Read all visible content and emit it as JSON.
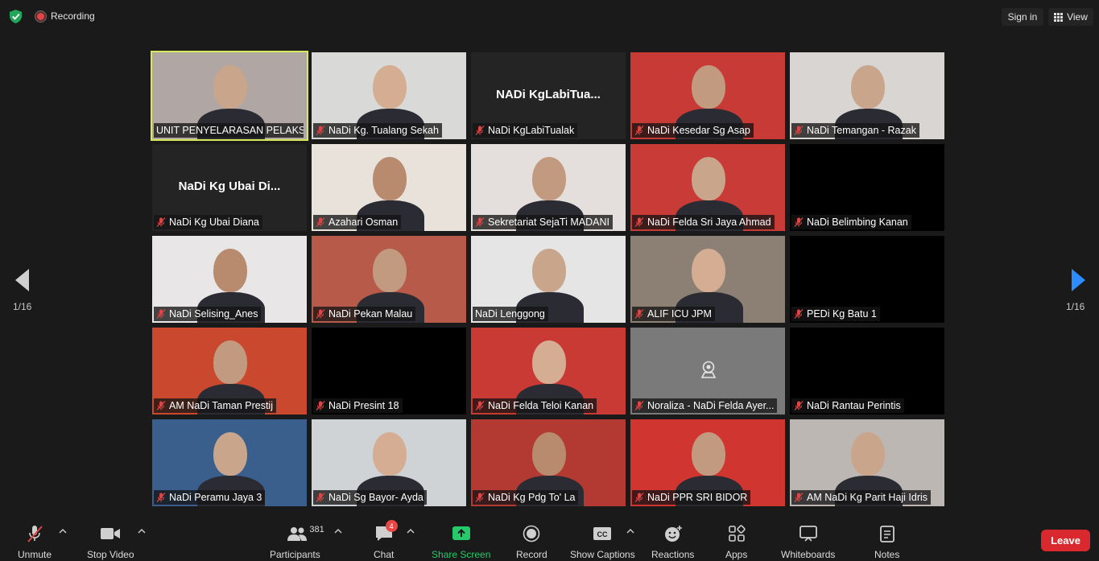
{
  "topbar": {
    "recording_label": "Recording",
    "signin_label": "Sign in",
    "view_label": "View"
  },
  "pagination": {
    "left": "1/16",
    "right": "1/16"
  },
  "tiles": [
    {
      "name": "UNIT PENYELARASAN PELAKS...",
      "muted": false,
      "active": true,
      "video": true,
      "bg": "#b0a7a4",
      "big": ""
    },
    {
      "name": "NaDi Kg. Tualang Sekah",
      "muted": true,
      "active": false,
      "video": true,
      "bg": "#d9d9d7",
      "big": ""
    },
    {
      "name": "NaDi KgLabiTualak",
      "muted": true,
      "active": false,
      "video": false,
      "bg": "#242424",
      "big": "NADi  KgLabiTua..."
    },
    {
      "name": "NaDi Kesedar Sg Asap",
      "muted": true,
      "active": false,
      "video": true,
      "bg": "#c73a35",
      "big": ""
    },
    {
      "name": "NaDi Temangan - Razak",
      "muted": true,
      "active": false,
      "video": true,
      "bg": "#d8d5d3",
      "big": ""
    },
    {
      "name": "NaDi Kg Ubai Diana",
      "muted": true,
      "active": false,
      "video": false,
      "bg": "#242424",
      "big": "NaDi Kg Ubai Di..."
    },
    {
      "name": "Azahari Osman",
      "muted": true,
      "active": false,
      "video": true,
      "bg": "#e8e2da",
      "big": ""
    },
    {
      "name": "Sekretariat SejaTi MADANI",
      "muted": true,
      "active": false,
      "video": true,
      "bg": "#e4dfdc",
      "big": ""
    },
    {
      "name": "NaDi Felda Sri Jaya Ahmad",
      "muted": true,
      "active": false,
      "video": true,
      "bg": "#c83b36",
      "big": ""
    },
    {
      "name": "NaDi Belimbing Kanan",
      "muted": true,
      "active": false,
      "video": false,
      "bg": "#000000",
      "big": ""
    },
    {
      "name": "NaDi Selising_Anes",
      "muted": true,
      "active": false,
      "video": true,
      "bg": "#e9e6e7",
      "big": ""
    },
    {
      "name": "NaDi Pekan Malau",
      "muted": true,
      "active": false,
      "video": true,
      "bg": "#b85a4a",
      "big": ""
    },
    {
      "name": "NaDi Lenggong",
      "muted": false,
      "active": false,
      "video": true,
      "bg": "#e6e5e6",
      "big": ""
    },
    {
      "name": "ALIF ICU JPM",
      "muted": true,
      "active": false,
      "video": true,
      "bg": "#8c7f73",
      "big": ""
    },
    {
      "name": "PEDi Kg Batu 1",
      "muted": true,
      "active": false,
      "video": false,
      "bg": "#000000",
      "big": ""
    },
    {
      "name": "AM NaDi Taman Prestij",
      "muted": true,
      "active": false,
      "video": true,
      "bg": "#c9482e",
      "big": ""
    },
    {
      "name": "NaDi Presint 18",
      "muted": true,
      "active": false,
      "video": false,
      "bg": "#000000",
      "big": ""
    },
    {
      "name": "NaDi Felda Teloi Kanan",
      "muted": true,
      "active": false,
      "video": true,
      "bg": "#c93a34",
      "big": ""
    },
    {
      "name": "Noraliza - NaDi Felda Ayer...",
      "muted": true,
      "active": false,
      "video": false,
      "bg": "#7a7a7a",
      "big": ""
    },
    {
      "name": "NaDi Rantau Perintis",
      "muted": true,
      "active": false,
      "video": false,
      "bg": "#000000",
      "big": ""
    },
    {
      "name": "NaDi Peramu Jaya 3",
      "muted": true,
      "active": false,
      "video": true,
      "bg": "#3a5f8c",
      "big": ""
    },
    {
      "name": "NaDi Sg Bayor-  Ayda",
      "muted": true,
      "active": false,
      "video": true,
      "bg": "#cfd3d6",
      "big": ""
    },
    {
      "name": "NaDi Kg Pdg To' La",
      "muted": true,
      "active": false,
      "video": true,
      "bg": "#b33a32",
      "big": ""
    },
    {
      "name": "NaDi PPR SRI BIDOR",
      "muted": true,
      "active": false,
      "video": true,
      "bg": "#d1352f",
      "big": ""
    },
    {
      "name": "AM NaDi Kg Parit Haji Idris",
      "muted": true,
      "active": false,
      "video": true,
      "bg": "#bdb7b4",
      "big": ""
    }
  ],
  "toolbar": {
    "unmute": "Unmute",
    "stop_video": "Stop Video",
    "participants": "Participants",
    "participant_count": "381",
    "chat": "Chat",
    "chat_badge": "4",
    "share_screen": "Share Screen",
    "record": "Record",
    "show_captions": "Show Captions",
    "reactions": "Reactions",
    "apps": "Apps",
    "whiteboards": "Whiteboards",
    "notes": "Notes",
    "leave": "Leave"
  },
  "colors": {
    "active_speaker": "#d7e85a",
    "share_green": "#27c96a",
    "leave_red": "#d9282e",
    "next_arrow": "#2d8cff"
  }
}
